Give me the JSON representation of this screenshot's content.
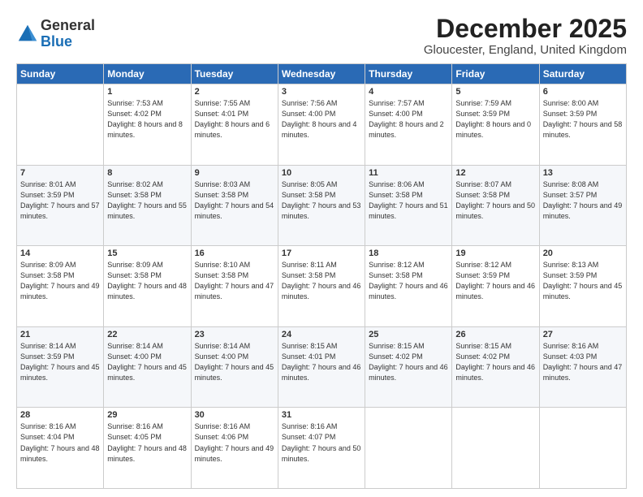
{
  "header": {
    "logo_general": "General",
    "logo_blue": "Blue",
    "month_title": "December 2025",
    "subtitle": "Gloucester, England, United Kingdom"
  },
  "weekdays": [
    "Sunday",
    "Monday",
    "Tuesday",
    "Wednesday",
    "Thursday",
    "Friday",
    "Saturday"
  ],
  "weeks": [
    [
      {
        "day": "",
        "sunrise": "",
        "sunset": "",
        "daylight": ""
      },
      {
        "day": "1",
        "sunrise": "Sunrise: 7:53 AM",
        "sunset": "Sunset: 4:02 PM",
        "daylight": "Daylight: 8 hours and 8 minutes."
      },
      {
        "day": "2",
        "sunrise": "Sunrise: 7:55 AM",
        "sunset": "Sunset: 4:01 PM",
        "daylight": "Daylight: 8 hours and 6 minutes."
      },
      {
        "day": "3",
        "sunrise": "Sunrise: 7:56 AM",
        "sunset": "Sunset: 4:00 PM",
        "daylight": "Daylight: 8 hours and 4 minutes."
      },
      {
        "day": "4",
        "sunrise": "Sunrise: 7:57 AM",
        "sunset": "Sunset: 4:00 PM",
        "daylight": "Daylight: 8 hours and 2 minutes."
      },
      {
        "day": "5",
        "sunrise": "Sunrise: 7:59 AM",
        "sunset": "Sunset: 3:59 PM",
        "daylight": "Daylight: 8 hours and 0 minutes."
      },
      {
        "day": "6",
        "sunrise": "Sunrise: 8:00 AM",
        "sunset": "Sunset: 3:59 PM",
        "daylight": "Daylight: 7 hours and 58 minutes."
      }
    ],
    [
      {
        "day": "7",
        "sunrise": "Sunrise: 8:01 AM",
        "sunset": "Sunset: 3:59 PM",
        "daylight": "Daylight: 7 hours and 57 minutes."
      },
      {
        "day": "8",
        "sunrise": "Sunrise: 8:02 AM",
        "sunset": "Sunset: 3:58 PM",
        "daylight": "Daylight: 7 hours and 55 minutes."
      },
      {
        "day": "9",
        "sunrise": "Sunrise: 8:03 AM",
        "sunset": "Sunset: 3:58 PM",
        "daylight": "Daylight: 7 hours and 54 minutes."
      },
      {
        "day": "10",
        "sunrise": "Sunrise: 8:05 AM",
        "sunset": "Sunset: 3:58 PM",
        "daylight": "Daylight: 7 hours and 53 minutes."
      },
      {
        "day": "11",
        "sunrise": "Sunrise: 8:06 AM",
        "sunset": "Sunset: 3:58 PM",
        "daylight": "Daylight: 7 hours and 51 minutes."
      },
      {
        "day": "12",
        "sunrise": "Sunrise: 8:07 AM",
        "sunset": "Sunset: 3:58 PM",
        "daylight": "Daylight: 7 hours and 50 minutes."
      },
      {
        "day": "13",
        "sunrise": "Sunrise: 8:08 AM",
        "sunset": "Sunset: 3:57 PM",
        "daylight": "Daylight: 7 hours and 49 minutes."
      }
    ],
    [
      {
        "day": "14",
        "sunrise": "Sunrise: 8:09 AM",
        "sunset": "Sunset: 3:58 PM",
        "daylight": "Daylight: 7 hours and 49 minutes."
      },
      {
        "day": "15",
        "sunrise": "Sunrise: 8:09 AM",
        "sunset": "Sunset: 3:58 PM",
        "daylight": "Daylight: 7 hours and 48 minutes."
      },
      {
        "day": "16",
        "sunrise": "Sunrise: 8:10 AM",
        "sunset": "Sunset: 3:58 PM",
        "daylight": "Daylight: 7 hours and 47 minutes."
      },
      {
        "day": "17",
        "sunrise": "Sunrise: 8:11 AM",
        "sunset": "Sunset: 3:58 PM",
        "daylight": "Daylight: 7 hours and 46 minutes."
      },
      {
        "day": "18",
        "sunrise": "Sunrise: 8:12 AM",
        "sunset": "Sunset: 3:58 PM",
        "daylight": "Daylight: 7 hours and 46 minutes."
      },
      {
        "day": "19",
        "sunrise": "Sunrise: 8:12 AM",
        "sunset": "Sunset: 3:59 PM",
        "daylight": "Daylight: 7 hours and 46 minutes."
      },
      {
        "day": "20",
        "sunrise": "Sunrise: 8:13 AM",
        "sunset": "Sunset: 3:59 PM",
        "daylight": "Daylight: 7 hours and 45 minutes."
      }
    ],
    [
      {
        "day": "21",
        "sunrise": "Sunrise: 8:14 AM",
        "sunset": "Sunset: 3:59 PM",
        "daylight": "Daylight: 7 hours and 45 minutes."
      },
      {
        "day": "22",
        "sunrise": "Sunrise: 8:14 AM",
        "sunset": "Sunset: 4:00 PM",
        "daylight": "Daylight: 7 hours and 45 minutes."
      },
      {
        "day": "23",
        "sunrise": "Sunrise: 8:14 AM",
        "sunset": "Sunset: 4:00 PM",
        "daylight": "Daylight: 7 hours and 45 minutes."
      },
      {
        "day": "24",
        "sunrise": "Sunrise: 8:15 AM",
        "sunset": "Sunset: 4:01 PM",
        "daylight": "Daylight: 7 hours and 46 minutes."
      },
      {
        "day": "25",
        "sunrise": "Sunrise: 8:15 AM",
        "sunset": "Sunset: 4:02 PM",
        "daylight": "Daylight: 7 hours and 46 minutes."
      },
      {
        "day": "26",
        "sunrise": "Sunrise: 8:15 AM",
        "sunset": "Sunset: 4:02 PM",
        "daylight": "Daylight: 7 hours and 46 minutes."
      },
      {
        "day": "27",
        "sunrise": "Sunrise: 8:16 AM",
        "sunset": "Sunset: 4:03 PM",
        "daylight": "Daylight: 7 hours and 47 minutes."
      }
    ],
    [
      {
        "day": "28",
        "sunrise": "Sunrise: 8:16 AM",
        "sunset": "Sunset: 4:04 PM",
        "daylight": "Daylight: 7 hours and 48 minutes."
      },
      {
        "day": "29",
        "sunrise": "Sunrise: 8:16 AM",
        "sunset": "Sunset: 4:05 PM",
        "daylight": "Daylight: 7 hours and 48 minutes."
      },
      {
        "day": "30",
        "sunrise": "Sunrise: 8:16 AM",
        "sunset": "Sunset: 4:06 PM",
        "daylight": "Daylight: 7 hours and 49 minutes."
      },
      {
        "day": "31",
        "sunrise": "Sunrise: 8:16 AM",
        "sunset": "Sunset: 4:07 PM",
        "daylight": "Daylight: 7 hours and 50 minutes."
      },
      {
        "day": "",
        "sunrise": "",
        "sunset": "",
        "daylight": ""
      },
      {
        "day": "",
        "sunrise": "",
        "sunset": "",
        "daylight": ""
      },
      {
        "day": "",
        "sunrise": "",
        "sunset": "",
        "daylight": ""
      }
    ]
  ]
}
